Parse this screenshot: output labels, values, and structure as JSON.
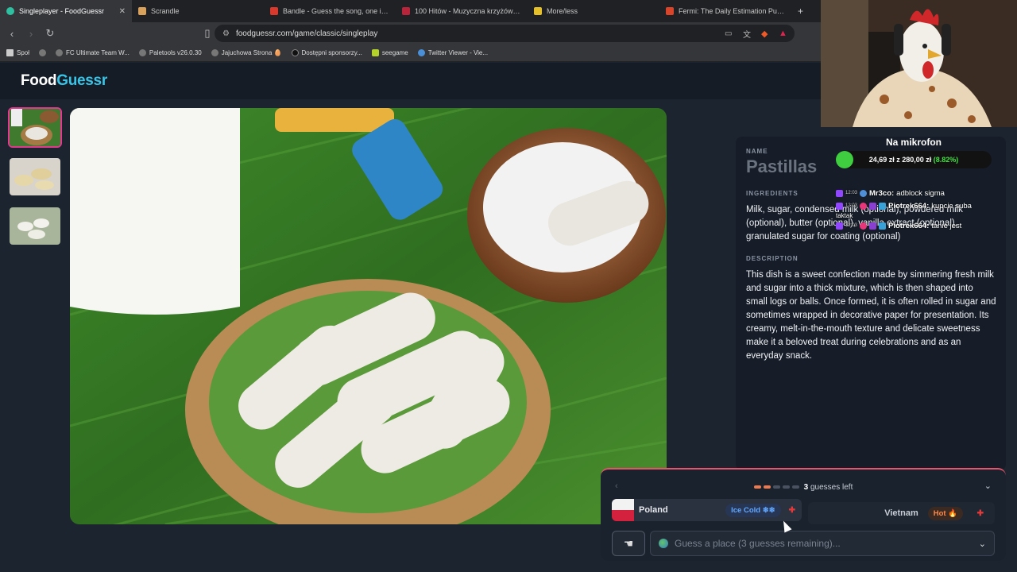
{
  "browser": {
    "tabs": [
      {
        "label": "Singleplayer - FoodGuessr",
        "color": "#2fbfa1",
        "active": true
      },
      {
        "label": "Scrandle",
        "color": "#d9a25c"
      },
      {
        "label": "Bandle - Guess the song, one instrument at a time",
        "color": "#d8392c"
      },
      {
        "label": "100 Hitów - Muzyczna krzyżówka online",
        "color": "#b8243a"
      },
      {
        "label": "More/less",
        "color": "#e6c02a"
      },
      {
        "label": "Fermi: The Daily Estimation Puzzle Game",
        "color": "#d9452b"
      }
    ],
    "url": "foodguessr.com/game/classic/singleplay",
    "bookmarks": [
      "Społ",
      "FC Ultimate Team W...",
      "Paletools v26.0.30",
      "Jajuchowa Strona 🥚",
      "Dostępni sponsorzy...",
      "seegame",
      "Twitter Viewer - Vie..."
    ]
  },
  "app": {
    "logo_food": "Food",
    "logo_guessr": "Guessr"
  },
  "dish": {
    "name_label": "Name",
    "name": "Pastillas",
    "ingredients_label": "Ingredients",
    "ingredients": "Milk, sugar, condensed milk (optional), powdered milk (optional), butter (optional), vanilla extract (optional), granulated sugar for coating (optional)",
    "description_label": "Description",
    "description": "This dish is a sweet confection made by simmering fresh milk and sugar into a thick mixture, which is then shaped into small logs or balls. Once formed, it is often rolled in sugar and sometimes wrapped in decorative paper for presentation. Its creamy, melt-in-the-mouth texture and delicate sweetness make it a beloved treat during celebrations and as an everyday snack."
  },
  "overlay": {
    "donate_title": "Na mikrofon",
    "donate_amount": "24,69 zł z 280,00 zł",
    "donate_pct": "(8.82%)",
    "donate_progress": 0.0882,
    "chat": [
      {
        "time": "12:03",
        "user": "Mr3co:",
        "msg": "adblock sigma"
      },
      {
        "time": "12:03",
        "user": "Piotrek664:",
        "msg": "kupcie suba"
      },
      {
        "time": "12:03",
        "user": "Piotrek664:",
        "msg": "tanie jest"
      }
    ],
    "chat_extra": "taktak"
  },
  "game": {
    "guesses_count": "3",
    "guesses_left_label": "guesses left",
    "guesses": [
      {
        "country": "Poland",
        "temp": "Ice Cold ❄❄"
      },
      {
        "country": "Vietnam",
        "temp": "Hot 🔥"
      }
    ],
    "search_placeholder": "Guess a place (3 guesses remaining)..."
  }
}
